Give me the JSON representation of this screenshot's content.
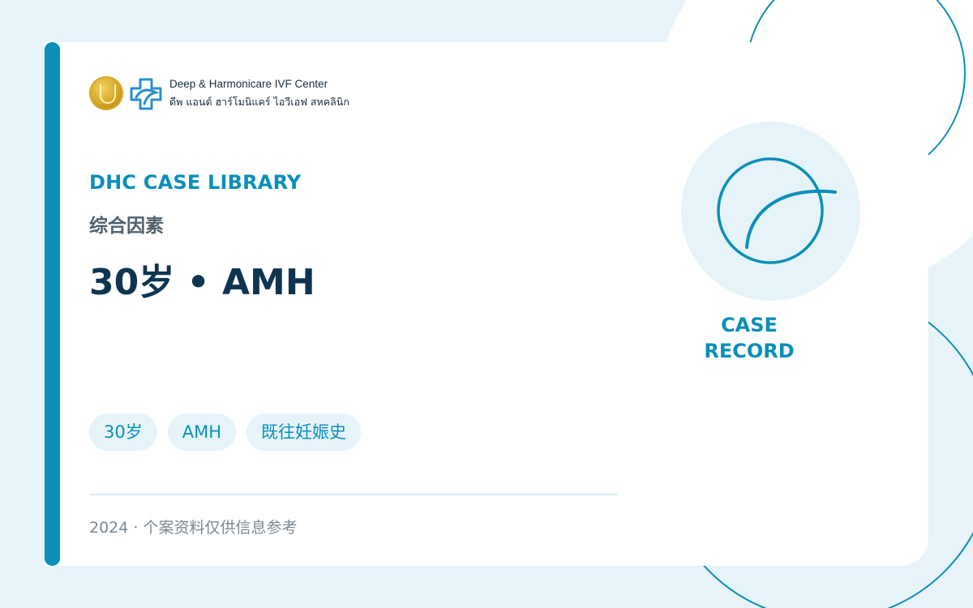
{
  "logo": {
    "name_en": "Deep & Harmonicare IVF Center",
    "name_th": "ดีพ แอนด์ ฮาร์โมนิแคร์ ไอวีเอฟ สหคลินิก"
  },
  "header": {
    "eyebrow": "DHC CASE LIBRARY",
    "category": "综合因素",
    "title": "30岁 • AMH"
  },
  "tags": [
    "30岁",
    "AMH",
    "既往妊娠史"
  ],
  "footer": {
    "text": "2024 · 个案资料仅供信息参考"
  },
  "badge": {
    "line1": "CASE",
    "line2": "RECORD",
    "icon": "case-record-icon"
  },
  "colors": {
    "accent": "#0b8fb8",
    "title": "#0e3550",
    "background": "#e8f4f9",
    "tag_bg": "#e6f4fa",
    "gold": "#c9951a"
  }
}
